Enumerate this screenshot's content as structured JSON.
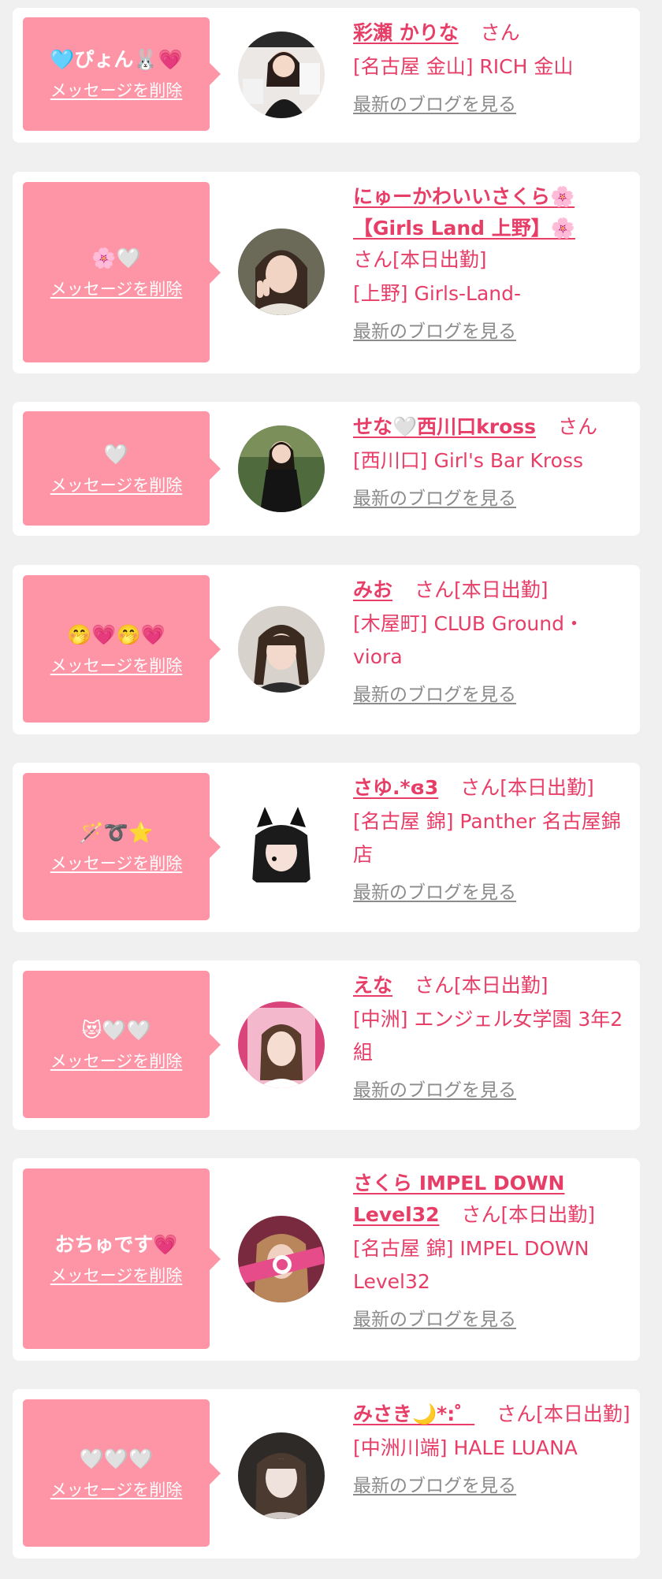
{
  "labels": {
    "delete_message": "メッセージを削除",
    "latest_blog": "最新のブログを見る"
  },
  "colors": {
    "page_bg": "#f0f0f1",
    "bubble": "#fe95a6",
    "accent_text": "#e73e68",
    "muted_link": "#8b8b8b"
  },
  "cards": [
    {
      "message": "🩵ぴょん🐰💗",
      "name": "彩瀬 かりな",
      "suffix": "さん",
      "shop": "[名古屋 金山] RICH 金山",
      "avatar_icon": "woman-portrait-bunny-poster"
    },
    {
      "message": "🌸🤍",
      "name": "にゅーかわいいさくら🌸【Girls Land 上野】🌸",
      "suffix": "さん[本日出勤]",
      "shop": "[上野] Girls-Land-",
      "avatar_icon": "woman-portrait-peace-sign"
    },
    {
      "message": "🤍",
      "name": "せな🤍西川口kross",
      "suffix": "さん",
      "shop": "[西川口] Girl's Bar Kross",
      "avatar_icon": "woman-portrait-standing"
    },
    {
      "message": "🤭💗🤭💗",
      "name": "みお",
      "suffix": "さん[本日出勤]",
      "shop": "[木屋町] CLUB Ground・viora",
      "avatar_icon": "woman-portrait-twin-braids"
    },
    {
      "message": "🪄➰⭐",
      "name": "さゆ.*ɞ3",
      "suffix": "さん[本日出勤]",
      "shop": "[名古屋 錦] Panther 名古屋錦店",
      "avatar_icon": "woman-portrait-cat-ears"
    },
    {
      "message": "😻🤍🤍",
      "name": "えな",
      "suffix": "さん[本日出勤]",
      "shop": "[中洲] エンジェル女学園 3年2組",
      "avatar_icon": "woman-portrait-pink-frame"
    },
    {
      "message": "おちゅです💗",
      "name": "さくら IMPEL DOWN Level32",
      "suffix": "さん[本日出勤]",
      "shop": "[名古屋 錦] IMPEL DOWN Level32",
      "avatar_icon": "woman-portrait-pink-badge"
    },
    {
      "message": "🤍🤍🤍",
      "name": "みさき🌙*:゜",
      "suffix": "さん[本日出勤]",
      "shop": "[中洲川端] HALE LUANA",
      "avatar_icon": "woman-portrait-dark-bg"
    }
  ]
}
